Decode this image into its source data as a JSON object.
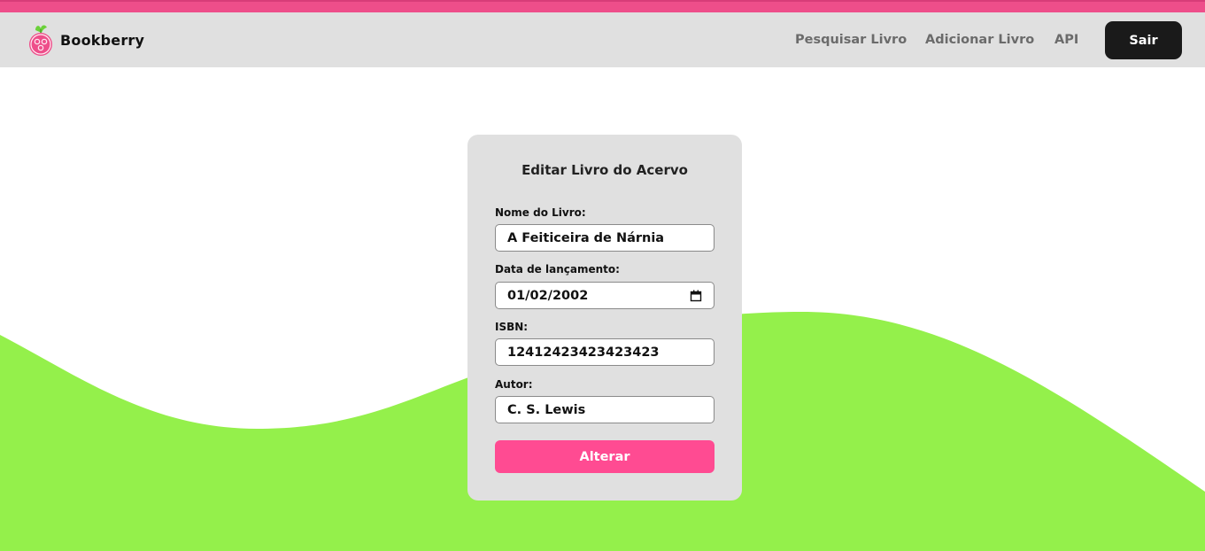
{
  "brand": {
    "name": "Bookberry"
  },
  "nav": {
    "links": [
      "Pesquisar Livro",
      "Adicionar Livro",
      "API"
    ],
    "logout_label": "Sair"
  },
  "form": {
    "title": "Editar Livro do Acervo",
    "name_label": "Nome do Livro:",
    "name_value": "A Feiticeira de Nárnia",
    "date_label": "Data de lançamento:",
    "date_value": "01/02/2002",
    "isbn_label": "ISBN:",
    "isbn_value": "12412423423423423",
    "author_label": "Autor:",
    "author_value": "C. S. Lewis",
    "submit_label": "Alterar"
  },
  "icons": {
    "logo": "raspberry-icon",
    "calendar": "calendar-icon"
  },
  "colors": {
    "accent_pink": "#ff4b92",
    "stripe_pink": "#ee4e8a",
    "wave_green": "#94f04b",
    "navbar_gray": "#e0e0e0",
    "button_dark": "#1a1a1a"
  }
}
